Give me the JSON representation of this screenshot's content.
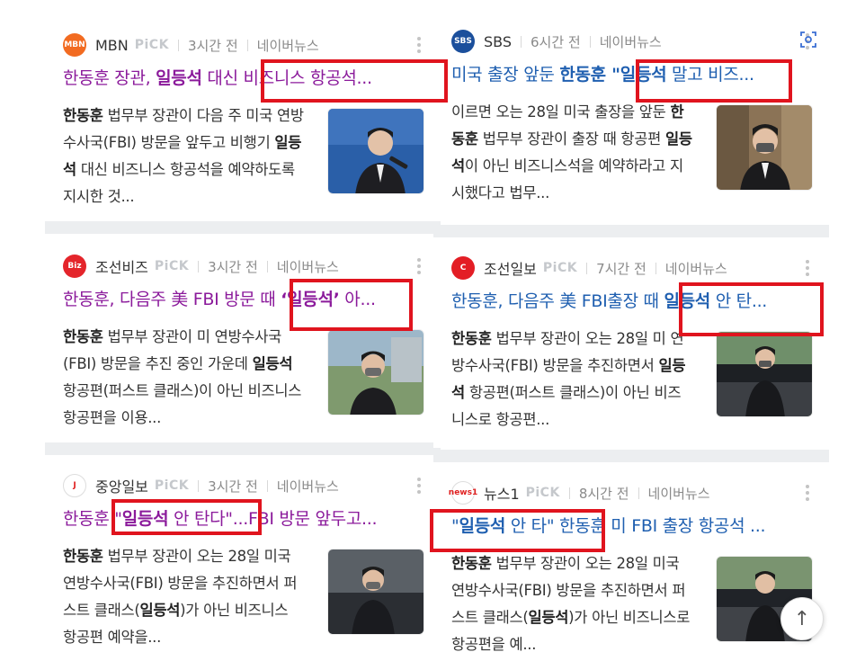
{
  "cards": [
    {
      "press": "MBN",
      "pick": "PiCK",
      "time": "3시간 전",
      "source": "네이버뉴스",
      "logo_text": "MBN",
      "logo_color": "#f26b21",
      "title_pre": "한동훈 장관, ",
      "title_bold": "일등석",
      "title_post": " 대신 비즈니스 항공석...",
      "body": [
        {
          "t": "한동훈",
          "b": true
        },
        {
          "t": " 법무부 장관이 다음 주 미국 연방수사국(FBI) 방문을 앞두고 비행기 ",
          "b": false
        },
        {
          "t": "일등석",
          "b": true
        },
        {
          "t": " 대신 비즈니스 항공석을 예약하도록 지시한 것...",
          "b": false
        }
      ],
      "thumb_icon": "photo-minister-speaking"
    },
    {
      "press": "SBS",
      "pick": "",
      "time": "6시간 전",
      "source": "네이버뉴스",
      "logo_text": "SBS",
      "logo_color": "#1b4f9c",
      "title_pre": "미국 출장 앞둔 ",
      "title_bold": "한동훈 \"일등석",
      "title_post": " 말고 비즈...",
      "body": [
        {
          "t": "이르면 오는 28일 미국 출장을 앞둔 ",
          "b": false
        },
        {
          "t": "한동훈",
          "b": true
        },
        {
          "t": " 법무부 장관이 출장 때 항공편 ",
          "b": false
        },
        {
          "t": "일등석",
          "b": true
        },
        {
          "t": "이 아닌 비즈니스석을 예약하라고 지시했다고 법무...",
          "b": false
        }
      ],
      "thumb_icon": "photo-minister-mask"
    },
    {
      "press": "조선비즈",
      "pick": "PiCK",
      "time": "3시간 전",
      "source": "네이버뉴스",
      "logo_text": "Biz",
      "logo_color": "#e4252b",
      "title_pre": "한동훈, 다음주 美 FBI 방문 때 ",
      "title_bold": "‘일등석’",
      "title_post": " 아...",
      "body": [
        {
          "t": "한동훈",
          "b": true
        },
        {
          "t": " 법무부 장관이 미 연방수사국(FBI) 방문을 추진 중인 가운데 ",
          "b": false
        },
        {
          "t": "일등석",
          "b": true
        },
        {
          "t": " 항공편(퍼스트 클래스)이 아닌 비즈니스 항공편을 이용...",
          "b": false
        }
      ],
      "thumb_icon": "photo-minister-mask-outdoor"
    },
    {
      "press": "조선일보",
      "pick": "PiCK",
      "time": "7시간 전",
      "source": "네이버뉴스",
      "logo_text": "C",
      "logo_color": "#e31e25",
      "title_pre": "한동훈, 다음주 美 FBI출장 때 ",
      "title_bold": "일등석",
      "title_post": " 안 탄...",
      "body": [
        {
          "t": "한동훈",
          "b": true
        },
        {
          "t": " 법무부 장관이 오는 28일 미 연방수사국(FBI) 방문을 추진하면서 ",
          "b": false
        },
        {
          "t": "일등석",
          "b": true
        },
        {
          "t": " 항공편(퍼스트 클래스)이 아닌 비즈니스로 항공편...",
          "b": false
        }
      ],
      "thumb_icon": "photo-minister-car"
    },
    {
      "press": "중앙일보",
      "pick": "PiCK",
      "time": "3시간 전",
      "source": "네이버뉴스",
      "logo_text": "J",
      "logo_color": "#ffffff",
      "title_pre": "한동훈 \"",
      "title_bold": "일등석",
      "title_post": " 안 탄다\"...FBI 방문 앞두고...",
      "body": [
        {
          "t": "한동훈",
          "b": true
        },
        {
          "t": " 법무부 장관이 오는 28일 미국 연방수사국(FBI) 방문을 추진하면서 퍼스트 클래스(",
          "b": false
        },
        {
          "t": "일등석",
          "b": true
        },
        {
          "t": ")가 아닌 비즈니스 항공편 예약을...",
          "b": false
        }
      ],
      "thumb_icon": "photo-minister-walking"
    },
    {
      "press": "뉴스1",
      "pick": "PiCK",
      "time": "8시간 전",
      "source": "네이버뉴스",
      "logo_text": "news1",
      "logo_color": "#ffffff",
      "title_pre": "\"",
      "title_bold": "일등석",
      "title_post": " 안 타\" 한동훈 미 FBI 출장 항공석 ...",
      "body": [
        {
          "t": "한동훈",
          "b": true
        },
        {
          "t": " 법무부 장관이 오는 28일 미국 연방수사국(FBI) 방문을 추진하면서 퍼스트 클래스(",
          "b": false
        },
        {
          "t": "일등석",
          "b": true
        },
        {
          "t": ")가 아닌 비즈니스로 항공편을 예...",
          "b": false
        }
      ],
      "thumb_icon": "photo-minister-car-2"
    }
  ],
  "icons": {
    "lens": "image-search-icon",
    "more": "more-vertical-icon",
    "top": "scroll-top-icon"
  },
  "colors": {
    "highlight": "#e0141e",
    "title_visited": "#8b1a9b",
    "title_link": "#1f5fb0",
    "separator": "#eceef0"
  },
  "scroll_top_glyph": "↑"
}
